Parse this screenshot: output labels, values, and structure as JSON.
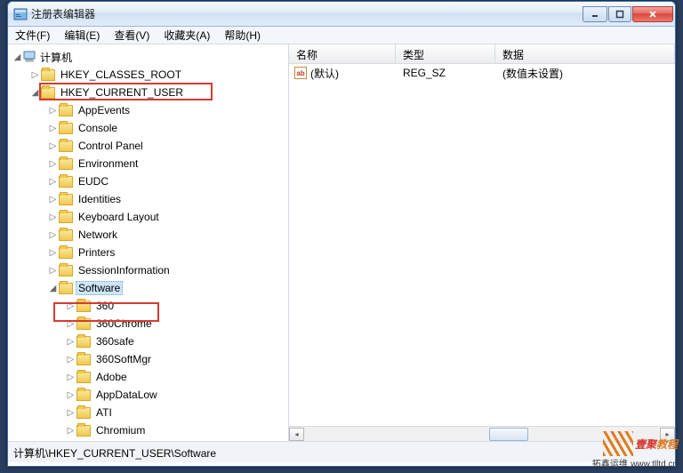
{
  "window": {
    "title": "注册表编辑器"
  },
  "menu": {
    "file": "文件(F)",
    "edit": "编辑(E)",
    "view": "查看(V)",
    "favorites": "收藏夹(A)",
    "help": "帮助(H)"
  },
  "tree": {
    "root": "计算机",
    "l1": [
      "HKEY_CLASSES_ROOT",
      "HKEY_CURRENT_USER"
    ],
    "hkcu": [
      "AppEvents",
      "Console",
      "Control Panel",
      "Environment",
      "EUDC",
      "Identities",
      "Keyboard Layout",
      "Network",
      "Printers",
      "SessionInformation",
      "Software"
    ],
    "software": [
      "360",
      "360Chrome",
      "360safe",
      "360SoftMgr",
      "Adobe",
      "AppDataLow",
      "ATI",
      "Chromium"
    ]
  },
  "list": {
    "headers": {
      "name": "名称",
      "type": "类型",
      "data": "数据"
    },
    "rows": [
      {
        "name": "(默认)",
        "type": "REG_SZ",
        "data": "(数值未设置)"
      }
    ]
  },
  "statusbar": {
    "path": "计算机\\HKEY_CURRENT_USER\\Software"
  },
  "glyphs": {
    "collapsed": "▷",
    "expanded": "◢",
    "ab": "ab"
  },
  "watermark": {
    "brand1": "壹聚",
    "brand2": "教程",
    "sub": "拓鑫运维",
    "url": "www.tlltd.cn"
  }
}
